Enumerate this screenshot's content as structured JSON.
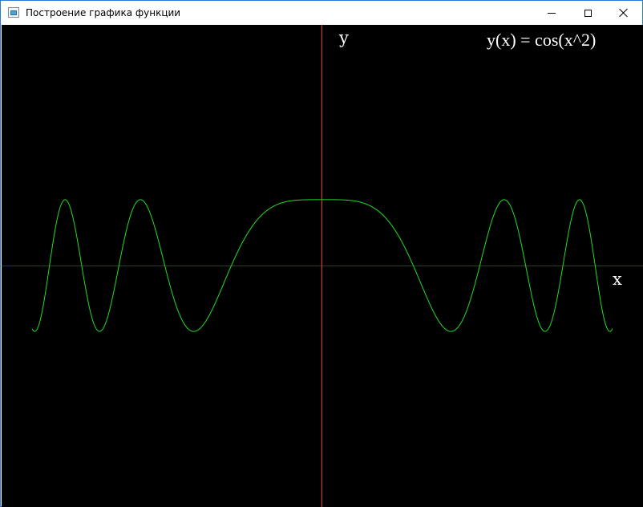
{
  "window": {
    "title": "Построение графика функции",
    "controls": {
      "minimize": "minimize",
      "maximize": "maximize",
      "close": "close"
    }
  },
  "plot": {
    "function_label": "y(x) = cos(x^2)",
    "x_axis_label": "x",
    "y_axis_label": "y",
    "colors": {
      "background": "#000000",
      "x_axis": "#1a1aff",
      "y_axis": "#ff2a2a",
      "curve": "#22dd22",
      "text": "#ffffff"
    }
  },
  "chart_data": {
    "type": "line",
    "function": "cos(x^2)",
    "xlim": [
      -4,
      4
    ],
    "ylim": [
      -3.3,
      3.3
    ],
    "grid": false
  }
}
